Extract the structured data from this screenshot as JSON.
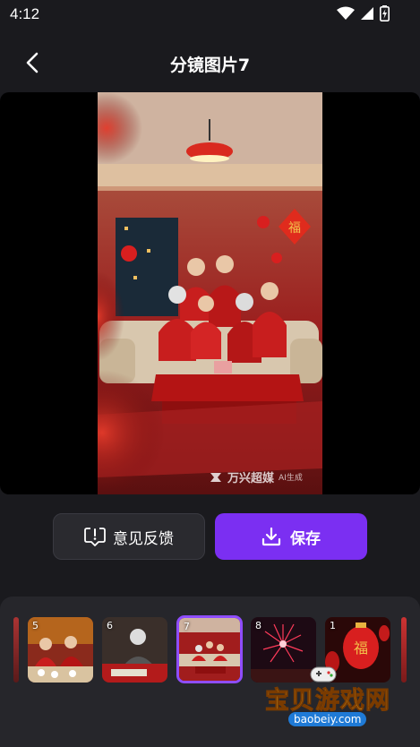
{
  "status_bar": {
    "time": "4:12"
  },
  "header": {
    "title": "分镜图片7"
  },
  "preview": {
    "watermark_brand": "万兴超媒",
    "watermark_tag": "AI生成"
  },
  "actions": {
    "feedback_label": "意见反馈",
    "save_label": "保存"
  },
  "thumbnails": [
    {
      "number": "5"
    },
    {
      "number": "6"
    },
    {
      "number": "7",
      "selected": true
    },
    {
      "number": "8"
    },
    {
      "number": "1"
    }
  ],
  "site_watermark": {
    "name": "宝贝游戏网",
    "url": "baobeiy.com"
  },
  "colors": {
    "accent": "#7b2ff2",
    "selection_border": "#8f4dff",
    "background": "#1a1a1e"
  }
}
